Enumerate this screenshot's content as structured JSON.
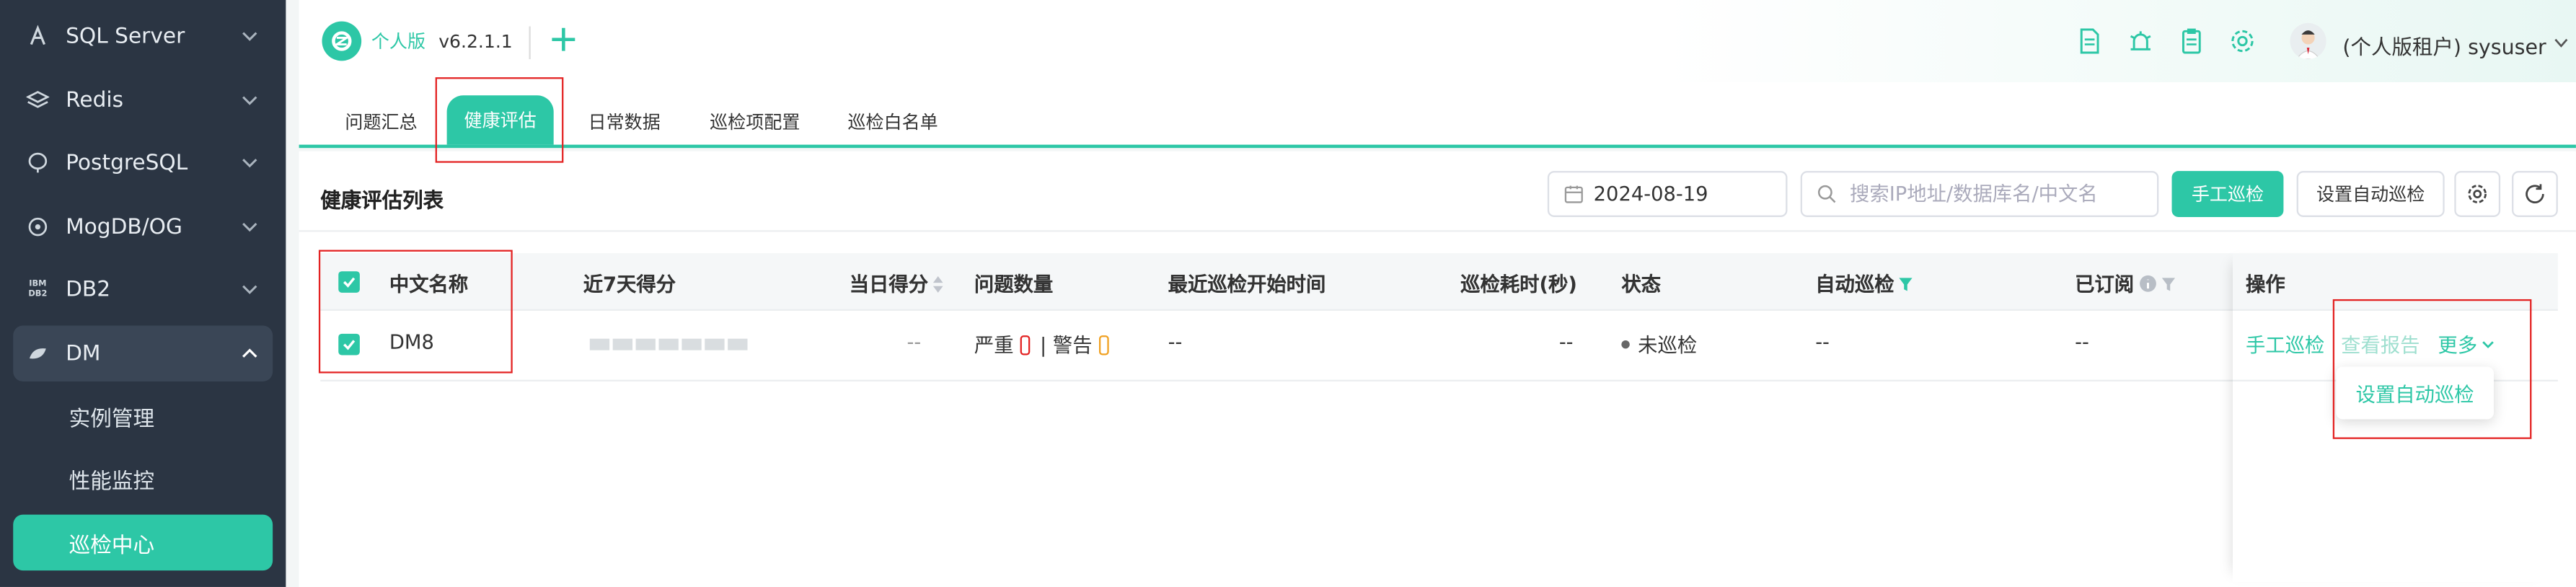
{
  "sidebar": {
    "items": [
      {
        "label": "SQL Server",
        "icon": "sqlserver-icon"
      },
      {
        "label": "Redis",
        "icon": "redis-icon"
      },
      {
        "label": "PostgreSQL",
        "icon": "postgresql-icon"
      },
      {
        "label": "MogDB/OG",
        "icon": "mogdb-icon"
      },
      {
        "label": "DB2",
        "icon": "db2-icon"
      },
      {
        "label": "DM",
        "icon": "dm-icon"
      }
    ],
    "db2_icon_text": "IBM DB2",
    "dm_subitems": [
      "实例管理",
      "性能监控",
      "巡检中心"
    ],
    "active_subitem": "巡检中心"
  },
  "header": {
    "edition": "个人版",
    "version": "v6.2.1.1",
    "user": "(个人版租户) sysuser"
  },
  "tabs": [
    {
      "label": "问题汇总"
    },
    {
      "label": "健康评估",
      "active": true
    },
    {
      "label": "日常数据"
    },
    {
      "label": "巡检项配置"
    },
    {
      "label": "巡检白名单"
    }
  ],
  "main": {
    "title": "健康评估列表",
    "date": "2024-08-19",
    "search_placeholder": "搜索IP地址/数据库名/中文名",
    "manual_button": "手工巡检",
    "auto_button": "设置自动巡检"
  },
  "table": {
    "columns": [
      "中文名称",
      "近7天得分",
      "当日得分",
      "问题数量",
      "最近巡检开始时间",
      "巡检耗时(秒)",
      "状态",
      "自动巡检",
      "已订阅",
      "操作"
    ],
    "rows": [
      {
        "name": "DM8",
        "today_score": "--",
        "severe_label": "严重",
        "severe_count": "0",
        "warn_label": "| 警告",
        "warn_count": "0",
        "last_start": "--",
        "duration": "--",
        "status": "未巡检",
        "auto": "--",
        "subscribed": "--",
        "ops": {
          "manual": "手工巡检",
          "report": "查看报告",
          "more": "更多"
        }
      }
    ]
  },
  "dropdown": {
    "item": "设置自动巡检"
  },
  "colors": {
    "accent": "#2dc7a6",
    "sidebar": "#2b3543",
    "highlight": "#e32222",
    "severe": "#e32222",
    "warning": "#f0a020"
  }
}
